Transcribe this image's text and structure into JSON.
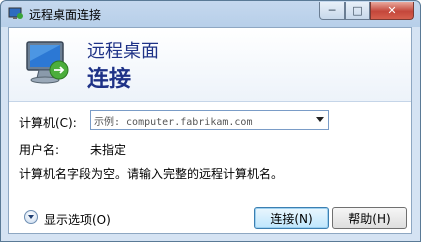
{
  "window": {
    "title": "远程桌面连接",
    "controls": {
      "minimize": "─",
      "maximize": "□",
      "close": "✕"
    }
  },
  "banner": {
    "line1": "远程桌面",
    "line2": "连接",
    "icon": "monitor-remote-icon"
  },
  "form": {
    "computer_label": "计算机(C):",
    "computer_placeholder": "示例: computer.fabrikam.com",
    "username_label": "用户名:",
    "username_value": "未指定",
    "message": "计算机名字段为空。请输入完整的远程计算机名。"
  },
  "footer": {
    "options_label": "显示选项(O)",
    "connect_label": "连接(N)",
    "help_label": "帮助(H)"
  },
  "colors": {
    "title_blue": "#1e3287",
    "chrome": "#c5d8ee",
    "close": "#c4473b"
  }
}
